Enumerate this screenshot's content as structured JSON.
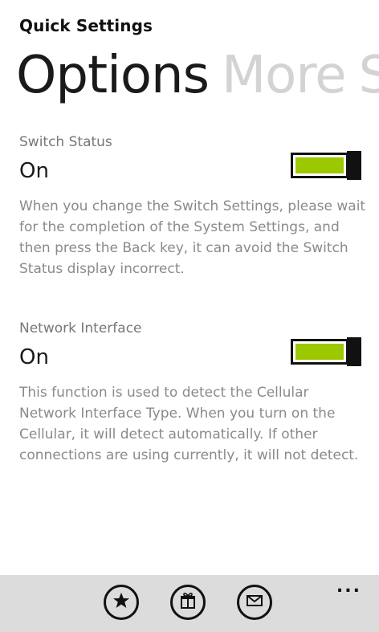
{
  "app": {
    "title": "Quick Settings"
  },
  "pivot": {
    "tabs": [
      {
        "label": "Options",
        "active": true
      },
      {
        "label": "More",
        "active": false
      }
    ]
  },
  "settings": [
    {
      "label": "Switch Status",
      "value": "On",
      "toggle_on": true,
      "description": "When you change the Switch Settings, please wait for the completion of the System Settings, and then press the Back key, it can avoid the Switch Status display incorrect."
    },
    {
      "label": "Network Interface",
      "value": "On",
      "toggle_on": true,
      "description": "This function is used to detect the Cellular Network Interface Type. When you turn on the Cellular, it will detect automatically. If other connections are using currently, it will not detect."
    }
  ],
  "appbar": {
    "buttons": [
      {
        "icon": "star-icon"
      },
      {
        "icon": "gift-icon"
      },
      {
        "icon": "mail-icon"
      }
    ],
    "more_label": "..."
  },
  "colors": {
    "accent": "#9cc800",
    "appbar_bg": "#dcdcdc",
    "inactive_tab": "#d3d3d3"
  }
}
